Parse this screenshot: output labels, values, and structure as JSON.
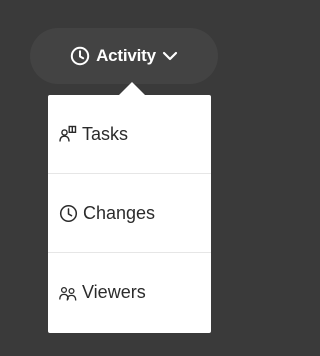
{
  "activity_button": {
    "label": "Activity",
    "icon": "clock-icon",
    "chevron_icon": "chevron-down-icon"
  },
  "menu": {
    "items": [
      {
        "label": "Tasks",
        "icon": "tasks-icon"
      },
      {
        "label": "Changes",
        "icon": "clock-icon"
      },
      {
        "label": "Viewers",
        "icon": "viewers-icon"
      }
    ]
  },
  "colors": {
    "background": "#3a3a3a",
    "button_bg": "#434343",
    "menu_bg": "#ffffff",
    "text_light": "#ffffff",
    "text_dark": "#2b2b2b"
  }
}
